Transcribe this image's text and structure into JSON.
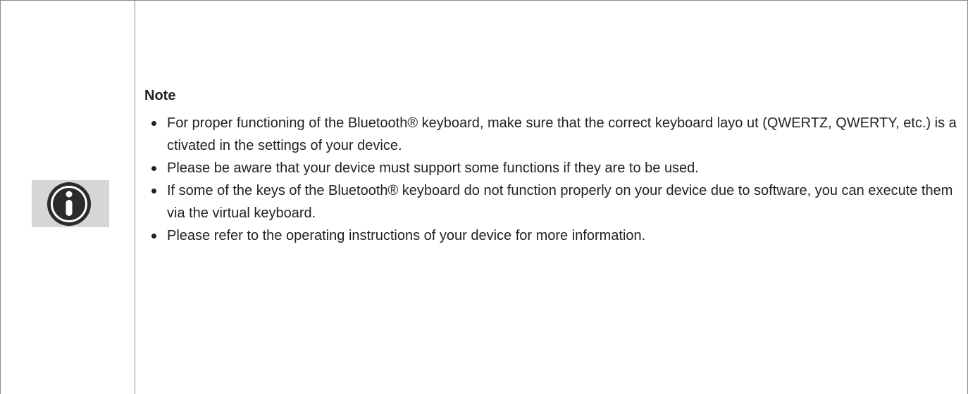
{
  "note": {
    "title": "Note",
    "items": [
      "For proper functioning of the Bluetooth® keyboard, make sure that the correct keyboard layo ut (QWERTZ, QWERTY, etc.) is activated in the settings of your device.",
      "Please be aware that your device must support some functions if they are to be used.",
      "If some of the keys of the Bluetooth® keyboard do not function properly on your device due to software, you can execute them via the virtual keyboard.",
      "Please refer to the operating instructions of your device for more information."
    ],
    "icon": "info-circle-icon"
  },
  "colors": {
    "border": "#8a8a8a",
    "icon_background": "#d6d6d6",
    "icon": "#2b2b2b",
    "text": "#222222"
  }
}
